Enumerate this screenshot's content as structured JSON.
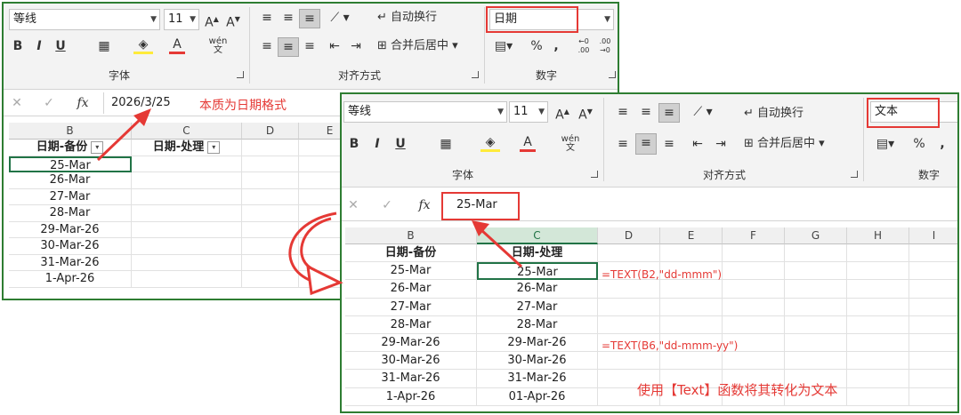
{
  "left": {
    "ribbon": {
      "font_name": "等线",
      "font_size": "11",
      "bold": "B",
      "italic": "I",
      "underline": "U",
      "wrap_text": "自动换行",
      "merge_center": "合并后居中",
      "number_format": "日期",
      "percent": "%",
      "comma": ",",
      "font_group": "字体",
      "align_group": "对齐方式",
      "number_group": "数字"
    },
    "formula": {
      "fx": "fx",
      "value": "2026/3/25"
    },
    "columns": [
      "B",
      "C",
      "D",
      "E"
    ],
    "headers": [
      "日期-备份",
      "日期-处理"
    ],
    "rows": [
      "25-Mar",
      "26-Mar",
      "27-Mar",
      "28-Mar",
      "29-Mar-26",
      "30-Mar-26",
      "31-Mar-26",
      "1-Apr-26"
    ],
    "annotation": "本质为日期格式"
  },
  "right": {
    "ribbon": {
      "font_name": "等线",
      "font_size": "11",
      "bold": "B",
      "italic": "I",
      "underline": "U",
      "wrap_text": "自动换行",
      "merge_center": "合并后居中",
      "number_format": "文本",
      "percent": "%",
      "font_group": "字体",
      "align_group": "对齐方式",
      "number_group": "数字"
    },
    "formula": {
      "fx": "fx",
      "value": "25-Mar"
    },
    "columns": [
      "B",
      "C",
      "D",
      "E",
      "F",
      "G",
      "H",
      "I"
    ],
    "headers": [
      "日期-备份",
      "日期-处理"
    ],
    "col_b": [
      "25-Mar",
      "26-Mar",
      "27-Mar",
      "28-Mar",
      "29-Mar-26",
      "30-Mar-26",
      "31-Mar-26",
      "1-Apr-26"
    ],
    "col_c": [
      "25-Mar",
      "26-Mar",
      "27-Mar",
      "28-Mar",
      "29-Mar-26",
      "30-Mar-26",
      "31-Mar-26",
      "01-Apr-26"
    ],
    "formula_note_1": "=TEXT(B2,\"dd-mmm\")",
    "formula_note_2": "=TEXT(B6,\"dd-mmm-yy\")",
    "annotation": "使用【Text】函数将其转化为文本"
  },
  "colors": {
    "frame": "#2e7d32",
    "annotation_red": "#e53935",
    "active_header": "#217346"
  }
}
